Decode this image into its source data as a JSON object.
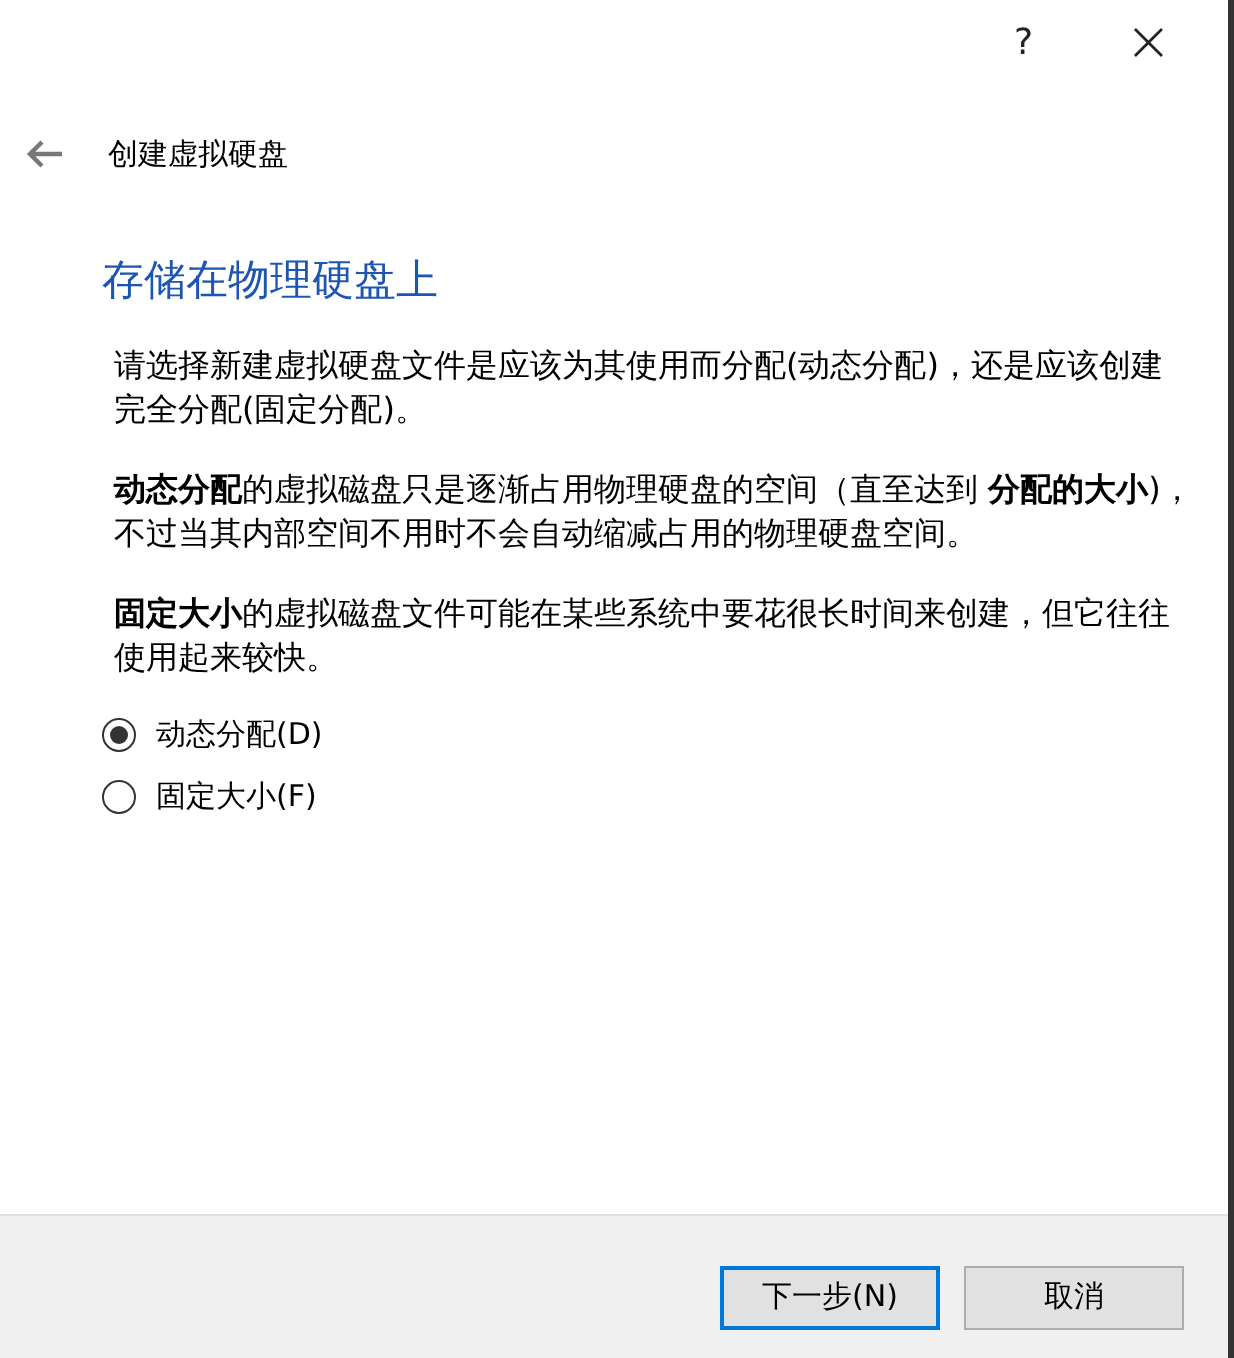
{
  "title_bar": {
    "help": "?",
    "close": "×"
  },
  "header": {
    "title": "创建虚拟硬盘"
  },
  "heading": "存储在物理硬盘上",
  "paragraphs": [
    "请选择新建虚拟硬盘文件是应该为其使用而分配(动态分配)，还是应该创建完全分配(固定分配)。",
    "**动态分配**的虚拟磁盘只是逐渐占用物理硬盘的空间（直至达到 **分配的大小**)，不过当其内部空间不用时不会自动缩减占用的物理硬盘空间。",
    "**固定大小**的虚拟磁盘文件可能在某些系统中要花很长时间来创建，但它往往使用起来较快。"
  ],
  "options": [
    {
      "label": "动态分配(D)",
      "selected": true
    },
    {
      "label": "固定大小(F)",
      "selected": false
    }
  ],
  "buttons": [
    {
      "label": "下一步(N)",
      "default": true
    },
    {
      "label": "取消",
      "default": false
    }
  ]
}
